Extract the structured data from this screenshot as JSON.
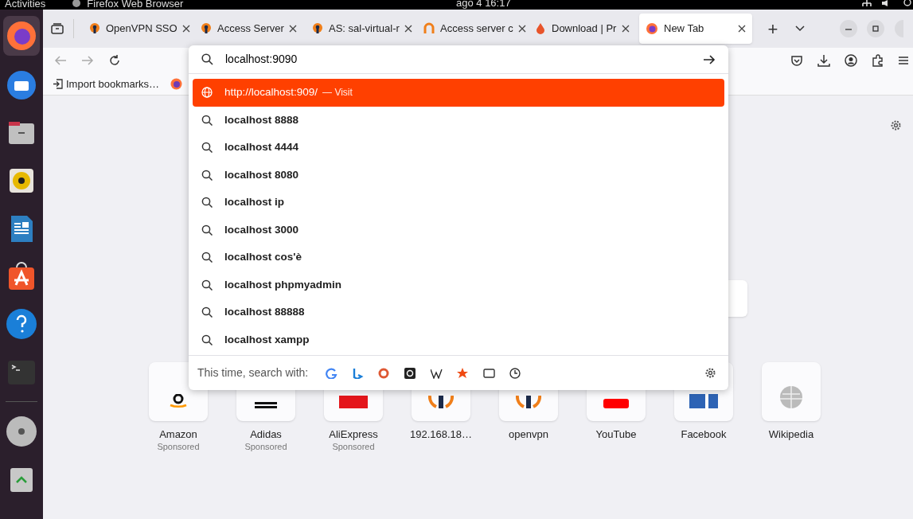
{
  "top_bar": {
    "activities": "Activities",
    "app_name": "Firefox Web Browser",
    "clock": "ago 4  16:17"
  },
  "dock": [
    {
      "kind": "firefox",
      "selected": true
    },
    {
      "kind": "mail",
      "selected": false
    },
    {
      "kind": "files",
      "selected": false
    },
    {
      "kind": "music",
      "selected": false
    },
    {
      "kind": "writer",
      "selected": false
    },
    {
      "kind": "store",
      "selected": false
    },
    {
      "kind": "help",
      "selected": false
    },
    {
      "kind": "terminal",
      "selected": false
    },
    {
      "kind": "disc",
      "selected": false
    },
    {
      "kind": "trash",
      "selected": false
    }
  ],
  "tabs": [
    {
      "label": "OpenVPN SSO",
      "kind": "vpn",
      "selected": false
    },
    {
      "label": "Access Server",
      "kind": "vpn",
      "selected": false
    },
    {
      "label": "AS: sal-virtual-r",
      "kind": "vpn",
      "selected": false
    },
    {
      "label": "Access server c",
      "kind": "ring",
      "selected": false
    },
    {
      "label": "Download | Pr",
      "kind": "drop",
      "selected": false
    },
    {
      "label": "New Tab",
      "kind": "firefox",
      "selected": true
    }
  ],
  "new_tab_button": "+",
  "address_bar": {
    "value": "localhost:9090"
  },
  "suggestions": [
    {
      "kind": "visit",
      "text": "http://localhost:909/",
      "action": "— Visit",
      "selected": true
    },
    {
      "kind": "search",
      "text": "localhost 8888",
      "selected": false
    },
    {
      "kind": "search",
      "text": "localhost 4444",
      "selected": false
    },
    {
      "kind": "search",
      "text": "localhost 8080",
      "selected": false
    },
    {
      "kind": "search",
      "text": "localhost ip",
      "selected": false
    },
    {
      "kind": "search",
      "text": "localhost 3000",
      "selected": false
    },
    {
      "kind": "search",
      "text": "localhost cos'è",
      "selected": false
    },
    {
      "kind": "search",
      "text": "localhost phpmyadmin",
      "selected": false
    },
    {
      "kind": "search",
      "text": "localhost 88888",
      "selected": false
    },
    {
      "kind": "search",
      "text": "localhost xampp",
      "selected": false
    }
  ],
  "search_with": {
    "label": "This time, search with:"
  },
  "bookmarks_bar": {
    "import": "Import bookmarks…"
  },
  "top_sites": [
    {
      "title": "Amazon",
      "sponsored": "Sponsored",
      "kind": "amazon"
    },
    {
      "title": "Adidas",
      "sponsored": "Sponsored",
      "kind": "adidas"
    },
    {
      "title": "AliExpress",
      "sponsored": "Sponsored",
      "kind": "ali"
    },
    {
      "title": "192.168.18…",
      "kind": "vpn"
    },
    {
      "title": "openvpn",
      "kind": "vpn"
    },
    {
      "title": "YouTube",
      "kind": "youtube"
    },
    {
      "title": "Facebook",
      "kind": "facebook"
    },
    {
      "title": "Wikipedia",
      "kind": "wiki"
    }
  ]
}
